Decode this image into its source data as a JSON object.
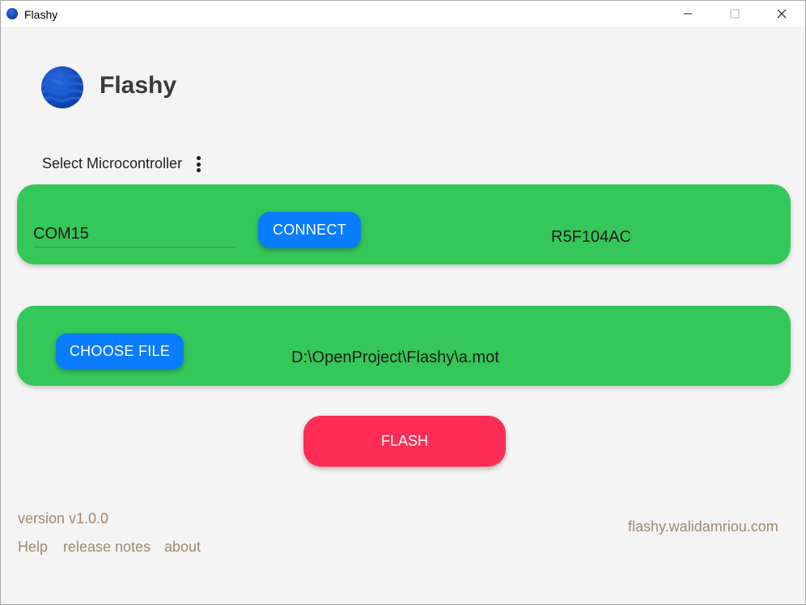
{
  "window": {
    "title": "Flashy",
    "minimize_glyph": "—",
    "maximize_glyph": "☐",
    "close_glyph": "✕"
  },
  "header": {
    "app_name": "Flashy",
    "logo_icon": "planet-icon"
  },
  "microcontroller": {
    "label": "Select Microcontroller",
    "menu_icon": "kebab-menu-icon"
  },
  "connection": {
    "port_value": "COM15",
    "connect_label": "CONNECT",
    "detected_mcu": "R5F104AC"
  },
  "file": {
    "choose_label": "CHOOSE FILE",
    "path": "D:\\OpenProject\\Flashy\\a.mot"
  },
  "flash": {
    "label": "FLASH"
  },
  "footer": {
    "version": "version v1.0.0",
    "links": [
      "Help",
      "release notes",
      "about"
    ],
    "website": "flashy.walidamriou.com"
  },
  "colors": {
    "card_green": "#34c759",
    "button_blue": "#0a7cff",
    "flash_red": "#ff2d55",
    "footer_text": "#a08a6e"
  }
}
